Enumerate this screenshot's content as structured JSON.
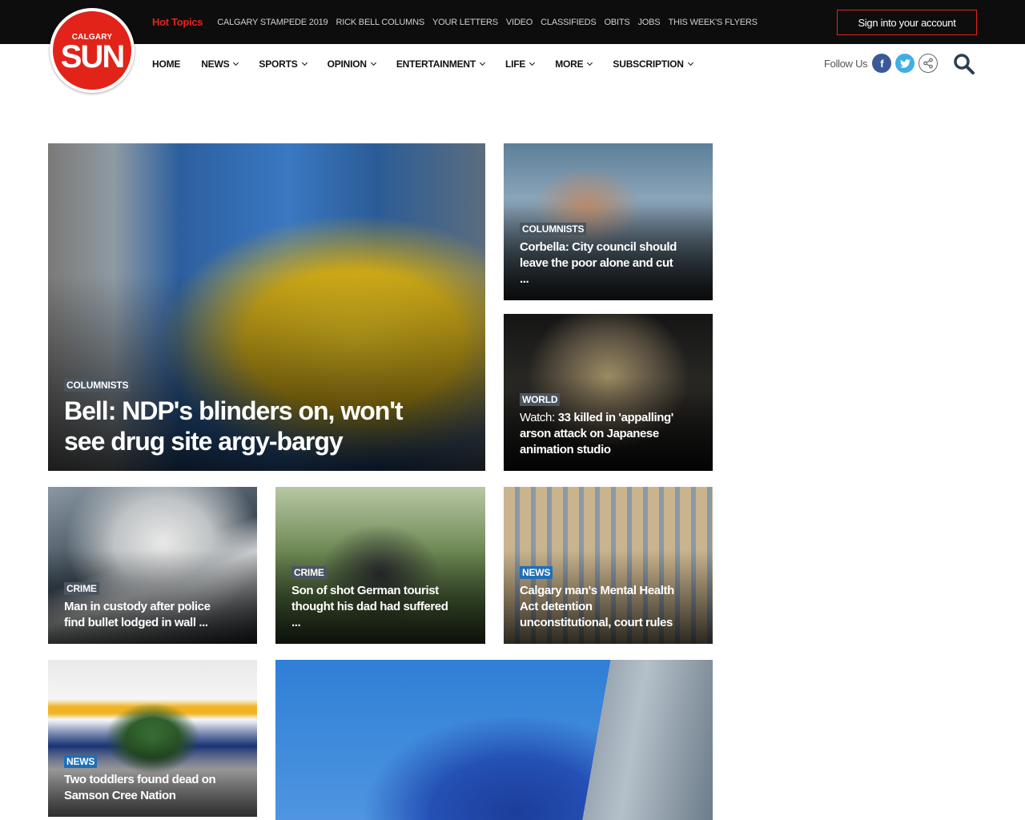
{
  "topbar": {
    "hot_topics_label": "Hot Topics",
    "links": [
      "CALGARY STAMPEDE 2019",
      "RICK BELL COLUMNS",
      "YOUR LETTERS",
      "VIDEO",
      "CLASSIFIEDS",
      "OBITS",
      "JOBS",
      "THIS WEEK'S FLYERS"
    ],
    "signin_label": "Sign into your account"
  },
  "logo": {
    "small": "CALGARY",
    "big": "SUN"
  },
  "nav": {
    "items": [
      "HOME",
      "NEWS",
      "SPORTS",
      "OPINION",
      "ENTERTAINMENT",
      "LIFE",
      "MORE",
      "SUBSCRIPTION"
    ],
    "has_dropdown": [
      false,
      true,
      true,
      true,
      true,
      true,
      true,
      true
    ]
  },
  "follow": {
    "label": "Follow Us",
    "icons": [
      "facebook-icon",
      "twitter-icon",
      "share-icon"
    ]
  },
  "colors": {
    "brand_red": "#e2231a",
    "topbar": "#0d0d0d",
    "tag_default": "#4a5560",
    "tag_news": "#1f6fb5"
  },
  "stories": [
    {
      "category": "COLUMNISTS",
      "prefix": "",
      "headline": "Bell: NDP's blinders on, won't see drug site argy-bargy"
    },
    {
      "category": "COLUMNISTS",
      "prefix": "",
      "headline": "Corbella: City council should leave the poor alone and cut ..."
    },
    {
      "category": "WORLD",
      "prefix": "Watch:",
      "headline": "33 killed in 'appalling' arson attack on Japanese animation studio"
    },
    {
      "category": "CRIME",
      "prefix": "",
      "headline": "Man in custody after police find bullet lodged in wall ..."
    },
    {
      "category": "CRIME",
      "prefix": "",
      "headline": "Son of shot German tourist thought his dad had suffered ..."
    },
    {
      "category": "NEWS",
      "prefix": "",
      "headline": "Calgary man's Mental Health Act detention unconstitutional, court rules"
    },
    {
      "category": "NEWS",
      "prefix": "",
      "headline": "Two toddlers found dead on Samson Cree Nation"
    }
  ]
}
